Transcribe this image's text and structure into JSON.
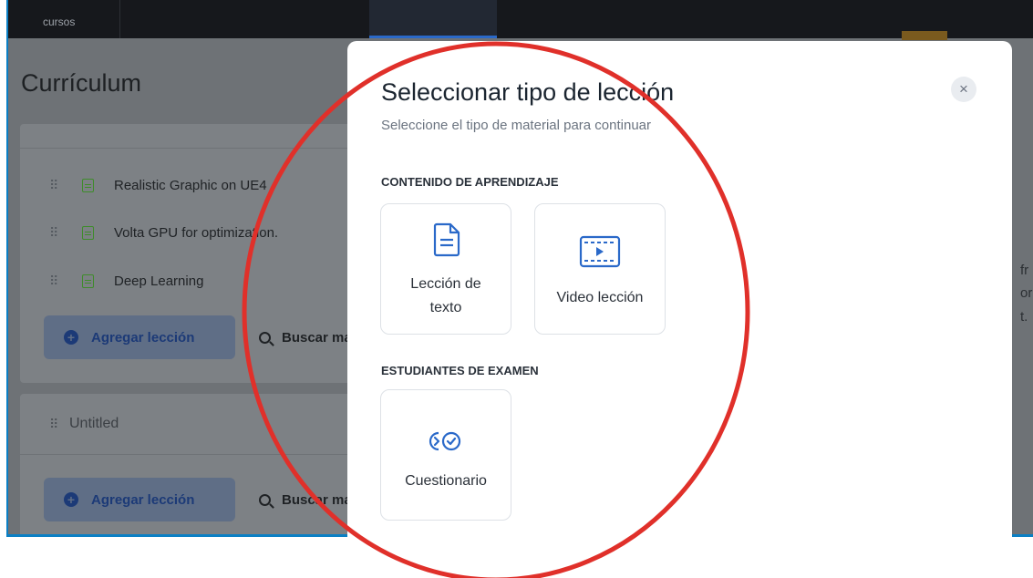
{
  "topbar": {
    "courses_label": "cursos"
  },
  "background": {
    "title": "Currículum",
    "lessons": [
      {
        "label": "Realistic Graphic on UE4"
      },
      {
        "label": "Volta GPU for optimization."
      },
      {
        "label": "Deep Learning"
      }
    ],
    "add_lesson_label": "Agregar lección",
    "search_label": "Buscar mat",
    "untitled_label": "Untitled",
    "side_text": [
      "fr",
      "or",
      "t."
    ]
  },
  "modal": {
    "title": "Seleccionar tipo de lección",
    "subtitle": "Seleccione el tipo de material para continuar",
    "close_symbol": "×",
    "learning_heading": "CONTENIDO DE APRENDIZAJE",
    "exam_heading": "ESTUDIANTES DE EXAMEN",
    "cards": {
      "text_lesson_line1": "Lección de",
      "text_lesson_line2": "texto",
      "video_lesson": "Video lección",
      "quiz": "Cuestionario"
    }
  },
  "colors": {
    "accent": "#2a69c9",
    "annotation": "#e0302a",
    "lesson_icon": "#3e8c2a"
  },
  "icons": [
    "document-icon",
    "video-icon",
    "quiz-icon",
    "close-icon",
    "drag-handle-icon",
    "plus-icon",
    "search-icon"
  ]
}
